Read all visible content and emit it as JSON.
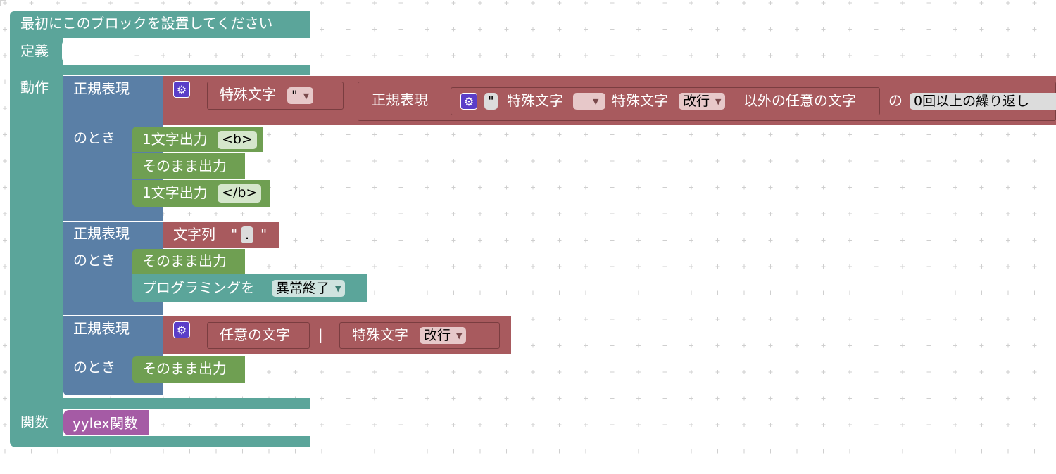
{
  "colors": {
    "teal": "#5ba59a",
    "blue": "#5a7fa6",
    "red": "#a85a5e",
    "green": "#6f9f52",
    "purple": "#a55ba5",
    "gear": "#5a3ec8"
  },
  "main_block": {
    "title": "最初にこのブロックを設置してください",
    "define_label": "定義",
    "action_label": "動作",
    "function_label": "関数"
  },
  "rules": [
    {
      "regex_label": "正規表現",
      "when_label": "のとき",
      "pattern": {
        "special1_label": "特殊文字",
        "special1_value": "\"",
        "inner_regex_label": "正規表現",
        "quote_glyph": "\"",
        "special2_label": "特殊文字",
        "special2_value": "",
        "special3_label": "特殊文字",
        "special3_value": "改行",
        "except_label": "以外の任意の文字",
        "of_label": "の",
        "repeat_value": "0回以上の繰り返し"
      },
      "actions": [
        {
          "label": "1文字出力",
          "value": "<b>"
        },
        {
          "label": "そのまま出力"
        },
        {
          "label": "1文字出力",
          "value": "</b>"
        }
      ]
    },
    {
      "regex_label": "正規表現",
      "when_label": "のとき",
      "pattern": {
        "string_label": "文字列",
        "quote_open": "\"",
        "string_value": ".",
        "quote_close": "\""
      },
      "actions": [
        {
          "label": "そのまま出力"
        },
        {
          "label": "プログラミングを",
          "value": "異常終了"
        }
      ]
    },
    {
      "regex_label": "正規表現",
      "when_label": "のとき",
      "pattern": {
        "any_char_label": "任意の文字",
        "or_glyph": "|",
        "special_label": "特殊文字",
        "special_value": "改行"
      },
      "actions": [
        {
          "label": "そのまま出力"
        }
      ]
    }
  ],
  "function_block": {
    "label": "yylex関数"
  },
  "icons": {
    "gear": "gear-icon",
    "dropdown": "dropdown-arrow-icon"
  }
}
